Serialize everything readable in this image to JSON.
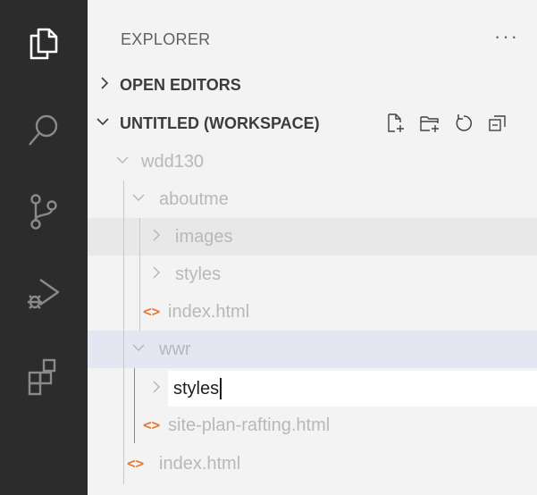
{
  "explorer": {
    "title": "EXPLORER",
    "more_label": "···"
  },
  "open_editors": {
    "label": "OPEN EDITORS",
    "expanded": false
  },
  "workspace": {
    "label": "UNTITLED (WORKSPACE)",
    "expanded": true,
    "actions": [
      "new-file-icon",
      "new-folder-icon",
      "refresh-icon",
      "collapse-all-icon"
    ]
  },
  "tree": {
    "root": "wdd130",
    "aboutme": "aboutme",
    "images": "images",
    "styles": "styles",
    "aboutme_index": "index.html",
    "wwr": "wwr",
    "rename_value": "styles",
    "site_plan": "site-plan-rafting.html",
    "root_index": "index.html",
    "file_icon_glyph": "<>"
  },
  "activity_bar": [
    "explorer-icon",
    "search-icon",
    "source-control-icon",
    "run-debug-icon",
    "extensions-icon"
  ],
  "colors": {
    "activity_bar": "#2c2c2c",
    "sidebar": "#f3f3f3",
    "selected_row": "#e4e6f1",
    "html_icon": "#e37933"
  }
}
